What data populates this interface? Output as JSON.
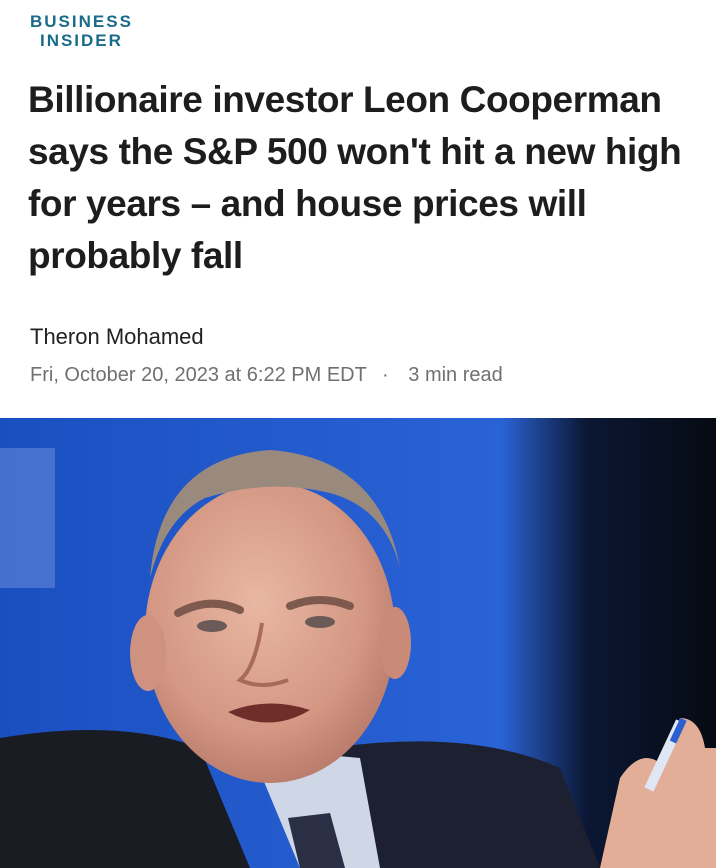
{
  "publisher": {
    "line1": "BUSINESS",
    "line2": "INSIDER"
  },
  "article": {
    "headline": "Billionaire investor Leon Cooperman says the S&P 500 won't hit a new high for years – and house prices will probably fall",
    "author": "Theron Mohamed",
    "date": "Fri, October 20, 2023 at 6:22 PM EDT",
    "separator": "·",
    "read_time": "3 min read"
  },
  "colors": {
    "brand": "#1a6b8a",
    "photo_bg": "#1f54c4"
  },
  "icons": [
    "business-insider-logo"
  ]
}
